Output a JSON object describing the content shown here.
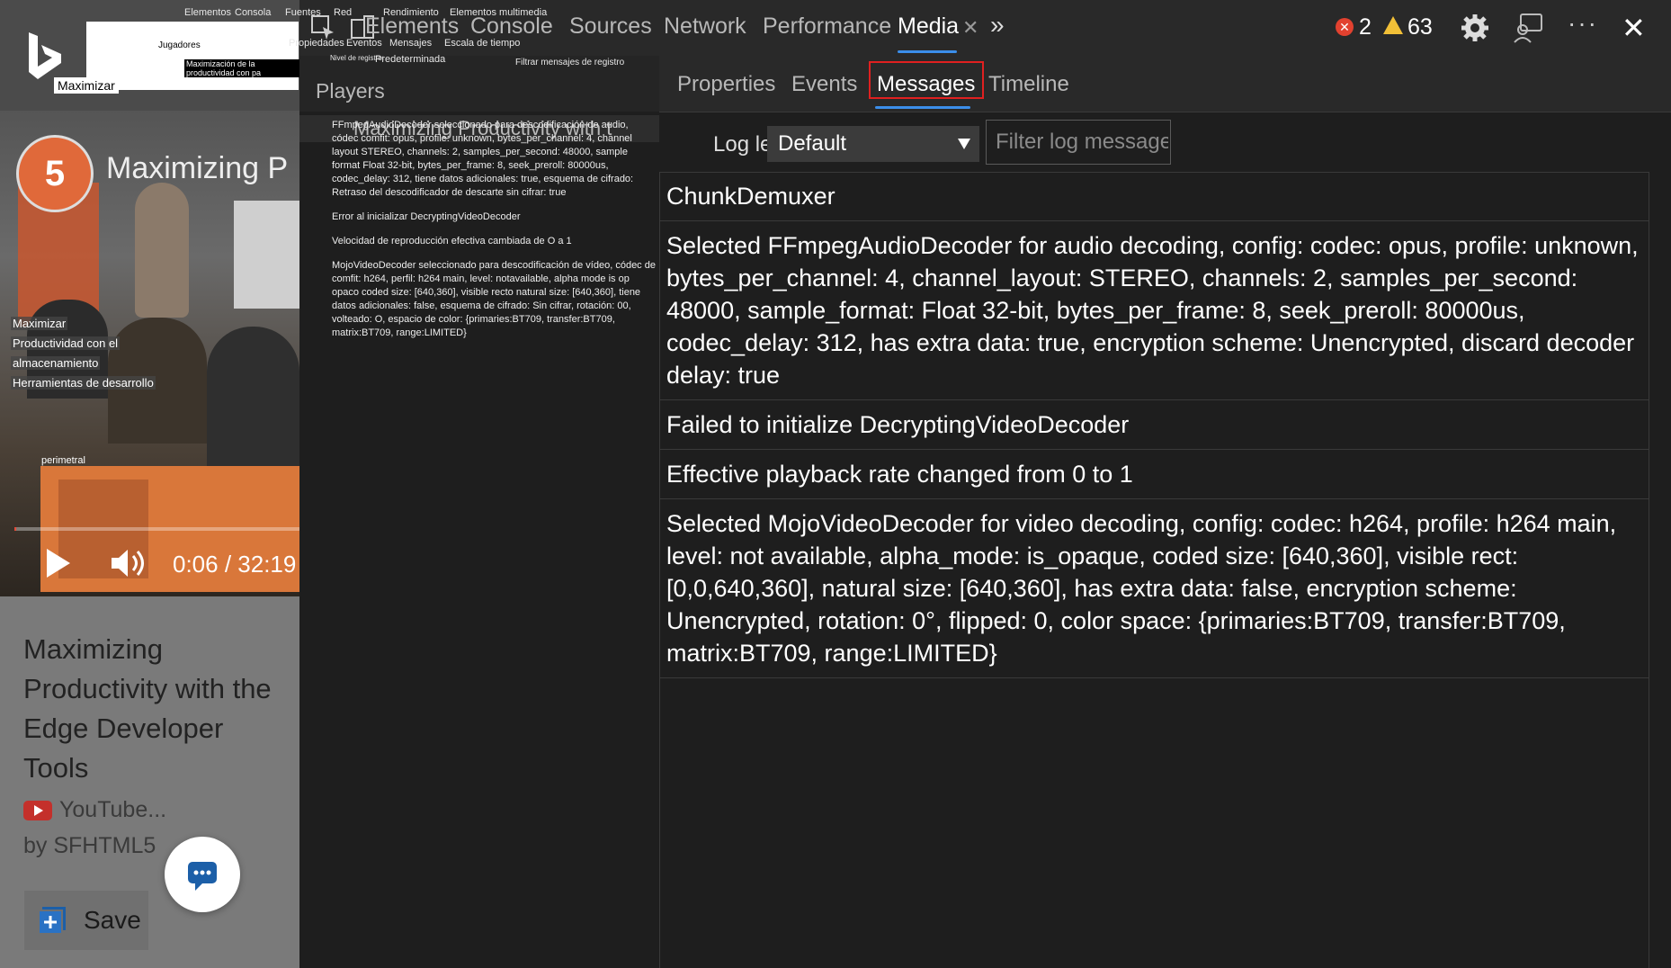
{
  "left": {
    "maximize_label": "Maximizar",
    "video_title_short": "Maximizing P",
    "avatar_text": "5",
    "overlay_notes": [
      "Maximizar",
      "Productividad con el",
      "almacenamiento",
      "Herramientas de desarrollo",
      "perimetral"
    ],
    "time": "0:06 / 32:19",
    "progress": 0.003,
    "card_title": "Maximizing Productivity with the Edge Developer Tools",
    "source": "YouTube...",
    "author": "by SFHTML5",
    "save_label": "Save"
  },
  "devtools": {
    "tabs": [
      "Elements",
      "Console",
      "Sources",
      "Network",
      "Performance",
      "Media"
    ],
    "active_tab": "Media",
    "error_count": "2",
    "warning_count": "63",
    "spanish_overlay": {
      "elementos": "Elementos",
      "consola": "Consola",
      "fuentes": "Fuentes",
      "red": "Red",
      "rendimiento": "Rendimiento",
      "multimedia": "Elementos multimedia",
      "propiedades": "Propiedades",
      "eventos": "Eventos",
      "mensajes": "Mensajes",
      "escala": "Escala de tiempo",
      "jugadores": "Jugadores",
      "maxprod": "Maximización de la productividad con pa",
      "nivel": "Nivel de registro:",
      "predeterminada": "Predeterminada",
      "filtrar": "Filtrar mensajes de registro"
    },
    "players": {
      "title": "Players",
      "row_text": "Maximizing Productivity with t"
    },
    "player_log_es": [
      "FFmpegAudioDecoder seleccionado para descodificación de audio, códec comfit: opus, profile: unknown, bytes_per_channel: 4, channel layout STEREO, channels: 2, samples_per_second: 48000, sample format Float 32-bit, bytes_per_frame: 8, seek_preroll: 80000us, codec_delay: 312, tiene datos adicionales: true, esquema de cifrado: Retraso del descodificador de descarte sin cifrar: true",
      "Error al inicializar DecryptingVideoDecoder",
      "Velocidad de reproducción efectiva cambiada de O a 1",
      "MojoVideoDecoder seleccionado para descodificación de vídeo, códec de comfit: h264, perfil: h264 main, level: notavailable, alpha mode is op opaco coded size: [640,360], visible recto natural size: [640,360], tiene datos adicionales: false, esquema de cifrado: Sin cifrar, rotación: 00, volteado: O, espacio de color: {primaries:BT709, transfer:BT709, matrix:BT709, range:LIMITED}"
    ],
    "subtabs": [
      "Properties",
      "Events",
      "Messages",
      "Timeline"
    ],
    "active_subtab": "Messages",
    "log_level_label": "Log level:",
    "log_level_value": "Default",
    "filter_placeholder": "Filter log messages",
    "messages": [
      "ChunkDemuxer",
      "Selected FFmpegAudioDecoder for audio decoding, config: codec: opus, profile: unknown, bytes_per_channel: 4, channel_layout: STEREO, channels: 2, samples_per_second: 48000, sample_format: Float 32-bit, bytes_per_frame: 8, seek_preroll: 80000us, codec_delay: 312, has extra data: true, encryption scheme: Unencrypted, discard decoder delay: true",
      "Failed to initialize DecryptingVideoDecoder",
      "Effective playback rate changed from 0 to 1",
      "Selected MojoVideoDecoder for video decoding, config: codec: h264, profile: h264 main, level: not available, alpha_mode: is_opaque, coded size: [640,360], visible rect: [0,0,640,360], natural size: [640,360], has extra data: false, encryption scheme: Unencrypted, rotation: 0°, flipped: 0, color space: {primaries:BT709, transfer:BT709, matrix:BT709, range:LIMITED}"
    ]
  },
  "colors": {
    "accent": "#3b8eea",
    "highlight": "#e02020",
    "error": "#e2412f",
    "warning": "#f2c037"
  }
}
